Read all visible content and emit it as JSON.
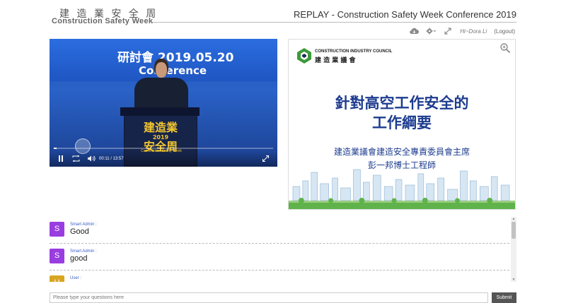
{
  "header": {
    "logo_cn": "建 造 業 安 全 周",
    "logo_en": "Construction Safety Week",
    "title": "REPLAY - Construction Safety Week Conference 2019"
  },
  "toolbar": {
    "icons": [
      "cloud-download-icon",
      "gear-icon",
      "expand-icon"
    ],
    "greeting": "Hi~Dora Li",
    "logout_label": "(Logout)"
  },
  "video": {
    "title_line1": "研討會 2019.05.20",
    "title_line2": "Conference",
    "podium_logo": "建造業 2019 安全周",
    "podium_logo_line1": "建造業",
    "podium_logo_line2": "2019",
    "podium_logo_line3": "安全周",
    "podium_sub": "Construction Safety Week",
    "current_time": "00:11",
    "separator": "/",
    "duration": "13:57",
    "progress": 0.013
  },
  "slide": {
    "org_en": "CONSTRUCTION INDUSTRY COUNCIL",
    "org_cn": "建 造 業 議 會",
    "title_line1": "針對高空工作安全的",
    "title_line2": "工作綱要",
    "sub_line1": "建造業議會建造安全專責委員會主席",
    "sub_line2": "彭一邦博士工程師",
    "brand_color": "#3d9a3a",
    "title_color": "#1d3c8f"
  },
  "chat": {
    "messages": [
      {
        "avatar": "S",
        "sender": "Smart Admin :",
        "text": "Good",
        "color": "#9a3de0"
      },
      {
        "avatar": "S",
        "sender": "Smart Admin :",
        "text": "good",
        "color": "#9a3de0"
      },
      {
        "avatar": "U",
        "sender": "User :",
        "text": "",
        "color": "#d9a520"
      }
    ]
  },
  "question": {
    "placeholder": "Please type your questions here",
    "submit_label": "Submit"
  }
}
